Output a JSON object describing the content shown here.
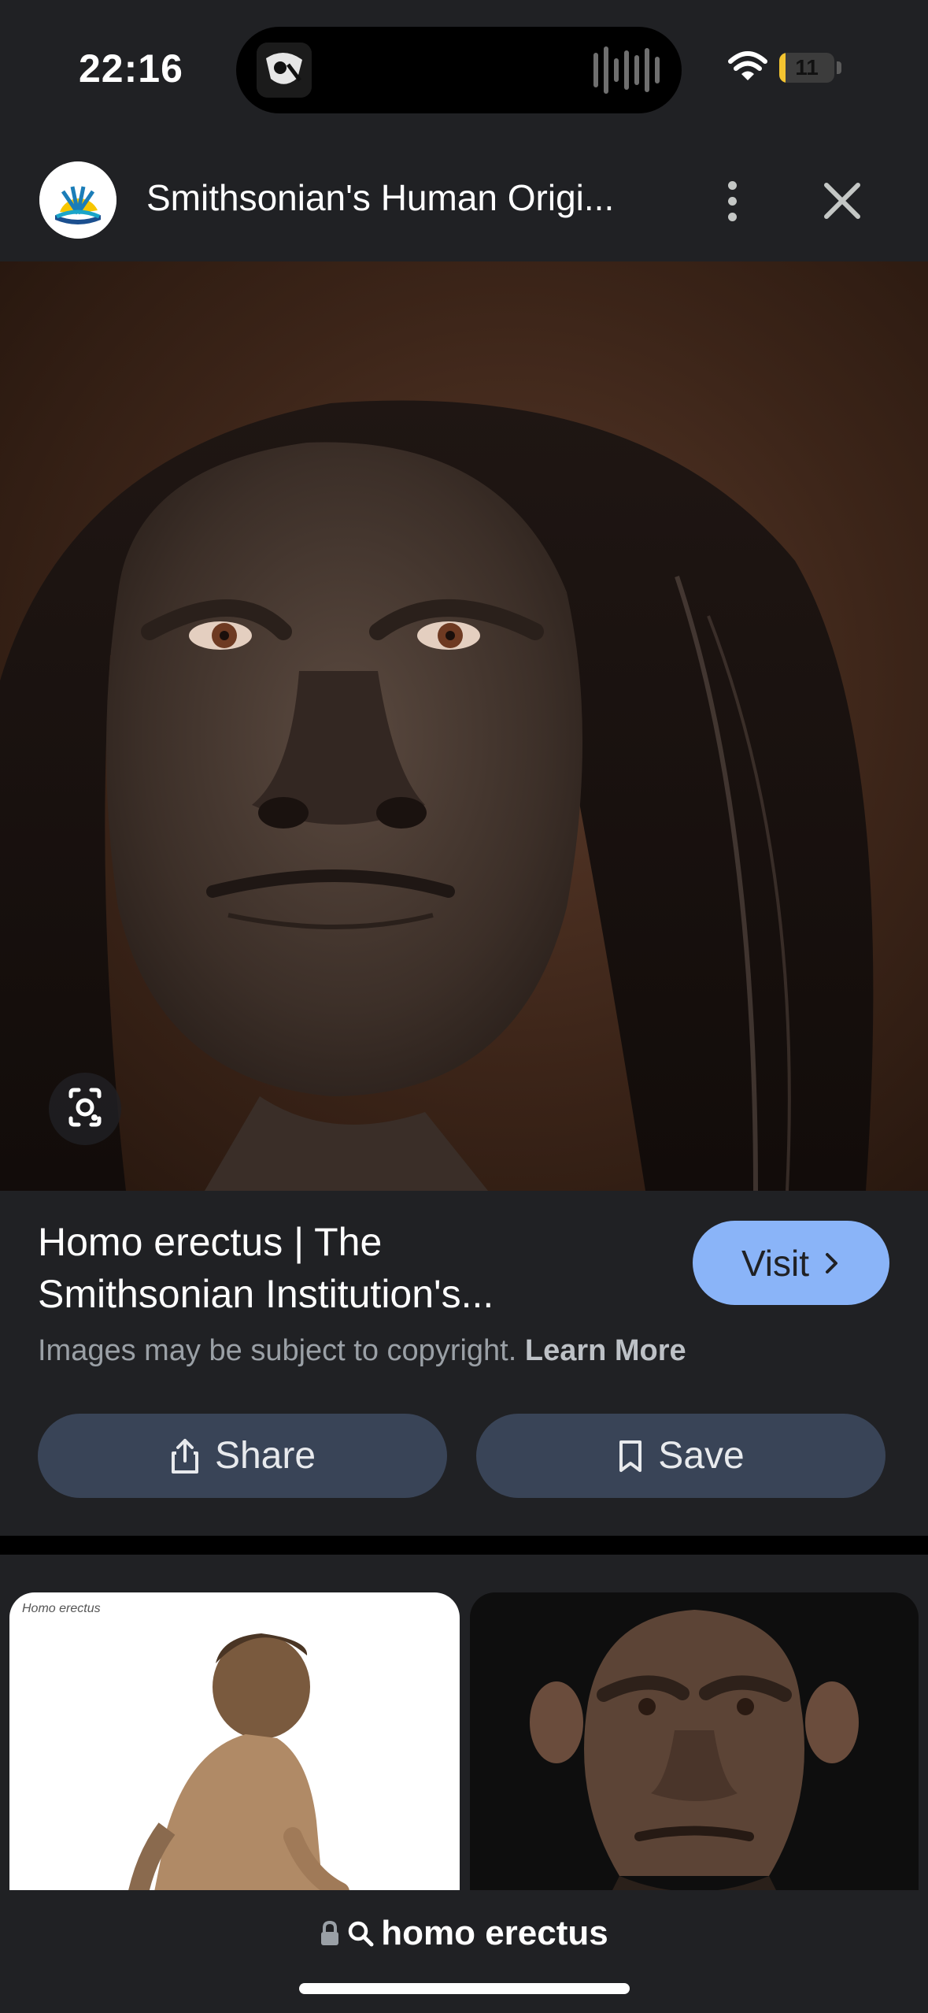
{
  "status_bar": {
    "time": "22:16",
    "battery": "11",
    "battery_level": 0.11
  },
  "header": {
    "site_title": "Smithsonian's Human Origi...",
    "more_icon": "more-vert-icon",
    "close_icon": "close-icon"
  },
  "result": {
    "title_line1": "Homo erectus | The",
    "title_line2": "Smithsonian Institution's...",
    "visit_label": "Visit",
    "copyright_text": "Images may be subject to copyright.",
    "learn_more": "Learn More",
    "share_label": "Share",
    "save_label": "Save"
  },
  "related": {
    "thumb1_caption": "Homo erectus"
  },
  "address_bar": {
    "query": "homo erectus"
  }
}
